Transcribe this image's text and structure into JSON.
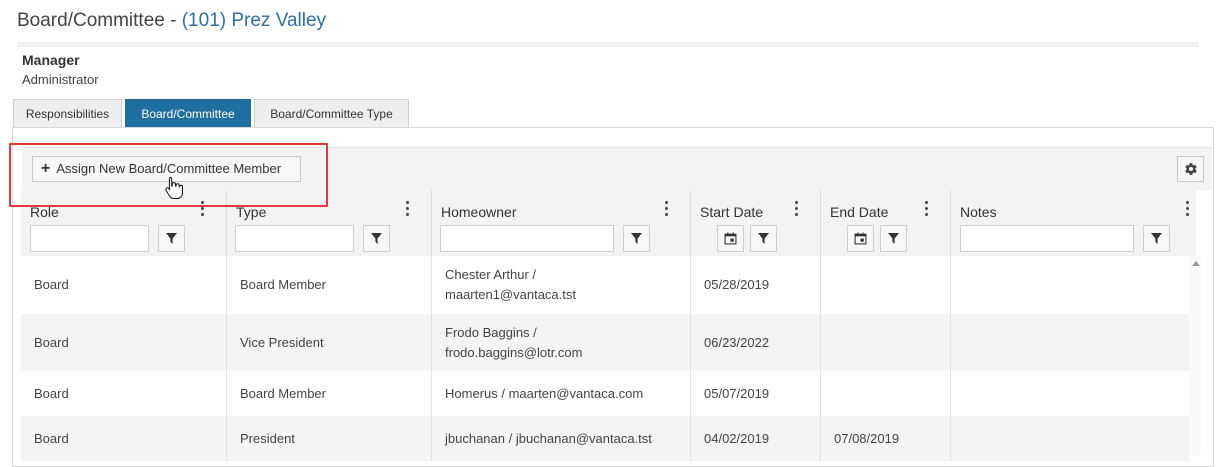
{
  "header": {
    "title_prefix": "Board/Committee - ",
    "title_link": "(101) Prez Valley"
  },
  "manager": {
    "role": "Manager",
    "name": "Administrator"
  },
  "tabs": [
    {
      "label": "Responsibilities",
      "active": false
    },
    {
      "label": "Board/Committee",
      "active": true
    },
    {
      "label": "Board/Committee Type",
      "active": false
    }
  ],
  "toolbar": {
    "assign_label": "Assign New Board/Committee Member",
    "assign_icon": "plus-icon",
    "settings_icon": "gear-icon"
  },
  "grid": {
    "columns": [
      {
        "label": "Role"
      },
      {
        "label": "Type"
      },
      {
        "label": "Homeowner"
      },
      {
        "label": "Start Date"
      },
      {
        "label": "End Date"
      },
      {
        "label": "Notes"
      }
    ],
    "rows": [
      {
        "role": "Board",
        "type": "Board Member",
        "homeowner_line1": "Chester Arthur /",
        "homeowner_line2": "maarten1@vantaca.tst",
        "start": "05/28/2019",
        "end": "",
        "notes": ""
      },
      {
        "role": "Board",
        "type": "Vice President",
        "homeowner_line1": "Frodo Baggins /",
        "homeowner_line2": "frodo.baggins@lotr.com",
        "start": "06/23/2022",
        "end": "",
        "notes": ""
      },
      {
        "role": "Board",
        "type": "Board Member",
        "homeowner_line1": "Homerus / maarten@vantaca.com",
        "homeowner_line2": "",
        "start": "05/07/2019",
        "end": "",
        "notes": ""
      },
      {
        "role": "Board",
        "type": "President",
        "homeowner_line1": "jbuchanan / jbuchanan@vantaca.tst",
        "homeowner_line2": "",
        "start": "04/02/2019",
        "end": "07/08/2019",
        "notes": ""
      }
    ]
  },
  "colors": {
    "tab_active": "#1e6f9f",
    "link": "#2f6fa7",
    "highlight": "#e03a3a"
  }
}
